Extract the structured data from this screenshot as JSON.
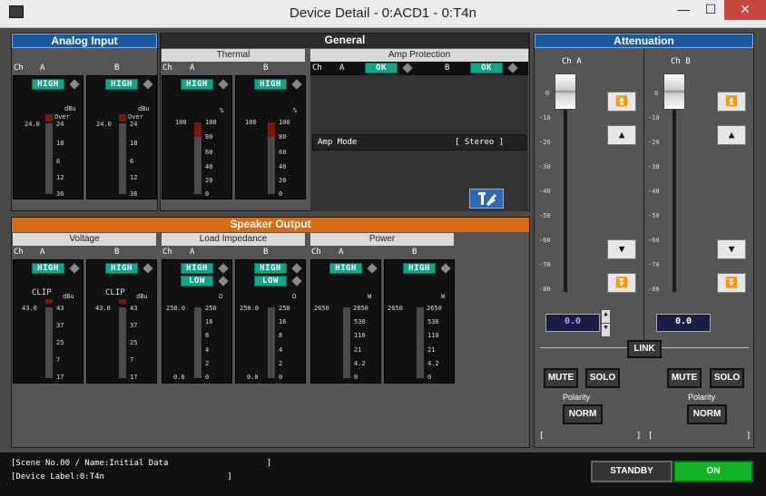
{
  "window": {
    "title": "Device Detail - 0:ACD1 - 0:T4n"
  },
  "analog": {
    "title": "Analog Input",
    "ch": "Ch",
    "a": "A",
    "b": "B",
    "high": "HIGH",
    "unit": "dBu",
    "over": "Over",
    "level": "24.0",
    "ticks": [
      "24",
      "18",
      "6",
      "12",
      "36"
    ]
  },
  "general": {
    "title": "General",
    "thermal": "Thermal",
    "amp_protection": "Amp Protection",
    "ch": "Ch",
    "a": "A",
    "b": "B",
    "high": "HIGH",
    "ok": "OK",
    "percent": "%",
    "level": "100",
    "ticks": [
      "100",
      "80",
      "60",
      "40",
      "20",
      "0"
    ],
    "amp_mode_label": "Amp Mode",
    "amp_mode_value": "[   Stereo   ]"
  },
  "speaker": {
    "title": "Speaker Output",
    "voltage": "Voltage",
    "load": "Load Impedance",
    "power": "Power",
    "ch": "Ch",
    "a": "A",
    "b": "B",
    "high": "HIGH",
    "low": "LOW",
    "clip": "CLIP",
    "dbu": "dBu",
    "ohm": "Ω",
    "watt": "W",
    "v_level": "43.0",
    "v_ticks": [
      "43",
      "37",
      "25",
      "7",
      "17"
    ],
    "l_level": "250.0",
    "l_bottom": "0.0",
    "l_ticks": [
      "250",
      "16",
      "8",
      "4",
      "2",
      "0"
    ],
    "p_level": "2650",
    "p_ticks": [
      "2650",
      "530",
      "110",
      "21",
      "4.2",
      "0"
    ]
  },
  "atten": {
    "title": "Attenuation",
    "ch_a": "Ch  A",
    "ch_b": "Ch  B",
    "ticks": [
      "0",
      "-10",
      "-20",
      "-30",
      "-40",
      "-50",
      "-60",
      "-70",
      "-80"
    ],
    "val_a": "0.0",
    "val_b": "0.0",
    "link": "LINK",
    "mute": "MUTE",
    "solo": "SOLO",
    "polarity": "Polarity",
    "norm": "NORM",
    "bracket_l": "[",
    "bracket_r": "]"
  },
  "status": {
    "scene": "[Scene No.00 / Name:Initial Data                    ]",
    "device": "[Device Label:0:T4n                         ]",
    "standby": "STANDBY",
    "on": "ON"
  }
}
